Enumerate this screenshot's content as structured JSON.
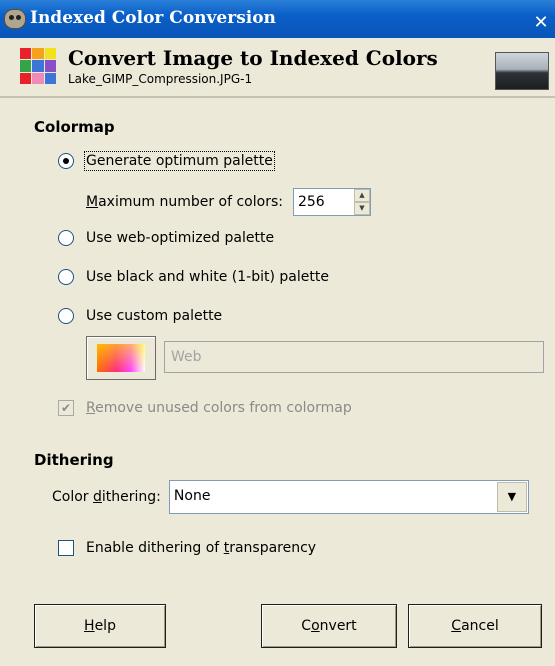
{
  "window": {
    "title": "Indexed Color Conversion",
    "close_glyph": "✕"
  },
  "header": {
    "title": "Convert Image to Indexed Colors",
    "subtitle": "Lake_GIMP_Compression.JPG-1"
  },
  "colormap": {
    "section_title": "Colormap",
    "options": [
      {
        "label": "Generate optimum palette",
        "selected": true
      },
      {
        "label": "Use web-optimized palette",
        "selected": false
      },
      {
        "label": "Use black and white (1-bit) palette",
        "selected": false
      },
      {
        "label": "Use custom palette",
        "selected": false
      }
    ],
    "max_colors": {
      "label_prefix": "M",
      "label_rest": "aximum number of colors:",
      "value": "256"
    },
    "custom_palette_name": "Web",
    "remove_unused": {
      "label_prefix": "R",
      "label_rest": "emove unused colors from colormap",
      "checked": true,
      "enabled": false
    }
  },
  "dithering": {
    "section_title": "Dithering",
    "color_dithering": {
      "label_a": "Color ",
      "label_u": "d",
      "label_b": "ithering:",
      "value": "None"
    },
    "transparency": {
      "label_a": "Enable dithering of ",
      "label_u": "t",
      "label_b": "ransparency",
      "checked": false
    }
  },
  "buttons": {
    "help": {
      "u": "H",
      "rest": "elp"
    },
    "convert": {
      "a": "C",
      "u": "o",
      "b": "nvert"
    },
    "cancel": {
      "u": "C",
      "rest": "ancel"
    }
  }
}
